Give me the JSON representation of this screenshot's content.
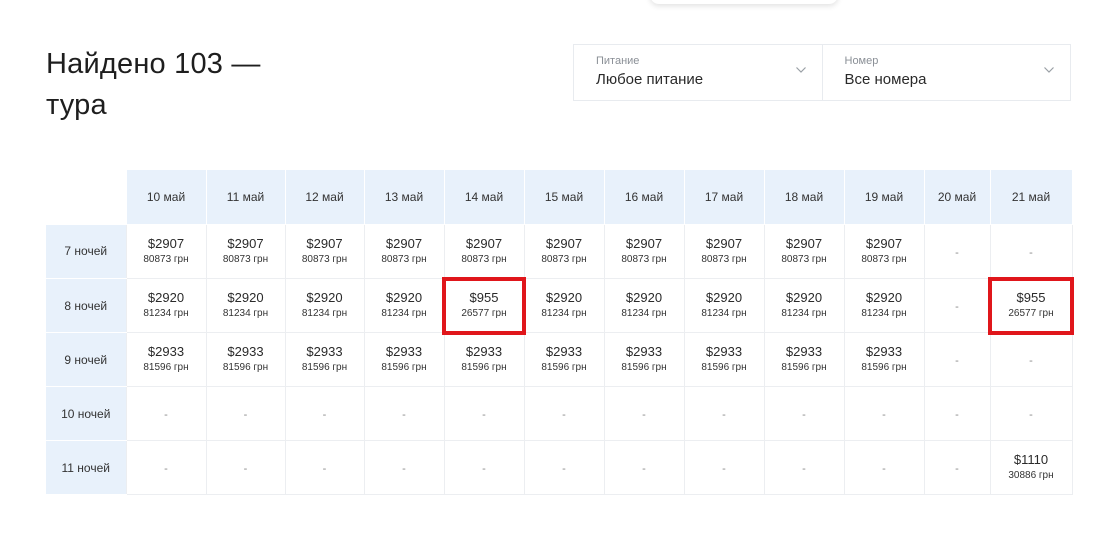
{
  "title": "Найдено 103 — тура",
  "filters": [
    {
      "label": "Питание",
      "value": "Любое питание"
    },
    {
      "label": "Номер",
      "value": "Все номера"
    }
  ],
  "dates": [
    "10 май",
    "11 май",
    "12 май",
    "13 май",
    "14 май",
    "15 май",
    "16 май",
    "17 май",
    "18 май",
    "19 май",
    "20 май",
    "21 май"
  ],
  "rows": [
    {
      "label": "7 ночей",
      "cells": [
        {
          "usd": "$2907",
          "uah": "80873 грн"
        },
        {
          "usd": "$2907",
          "uah": "80873 грн"
        },
        {
          "usd": "$2907",
          "uah": "80873 грн"
        },
        {
          "usd": "$2907",
          "uah": "80873 грн"
        },
        {
          "usd": "$2907",
          "uah": "80873 грн"
        },
        {
          "usd": "$2907",
          "uah": "80873 грн"
        },
        {
          "usd": "$2907",
          "uah": "80873 грн"
        },
        {
          "usd": "$2907",
          "uah": "80873 грн"
        },
        {
          "usd": "$2907",
          "uah": "80873 грн"
        },
        {
          "usd": "$2907",
          "uah": "80873 грн"
        },
        {
          "dash": "-"
        },
        {
          "dash": "-"
        }
      ]
    },
    {
      "label": "8 ночей",
      "cells": [
        {
          "usd": "$2920",
          "uah": "81234 грн"
        },
        {
          "usd": "$2920",
          "uah": "81234 грн"
        },
        {
          "usd": "$2920",
          "uah": "81234 грн"
        },
        {
          "usd": "$2920",
          "uah": "81234 грн"
        },
        {
          "usd": "$955",
          "uah": "26577 грн",
          "highlight": true
        },
        {
          "usd": "$2920",
          "uah": "81234 грн"
        },
        {
          "usd": "$2920",
          "uah": "81234 грн"
        },
        {
          "usd": "$2920",
          "uah": "81234 грн"
        },
        {
          "usd": "$2920",
          "uah": "81234 грн"
        },
        {
          "usd": "$2920",
          "uah": "81234 грн"
        },
        {
          "dash": "-"
        },
        {
          "usd": "$955",
          "uah": "26577 грн",
          "highlight": true
        }
      ]
    },
    {
      "label": "9 ночей",
      "cells": [
        {
          "usd": "$2933",
          "uah": "81596 грн"
        },
        {
          "usd": "$2933",
          "uah": "81596 грн"
        },
        {
          "usd": "$2933",
          "uah": "81596 грн"
        },
        {
          "usd": "$2933",
          "uah": "81596 грн"
        },
        {
          "usd": "$2933",
          "uah": "81596 грн"
        },
        {
          "usd": "$2933",
          "uah": "81596 грн"
        },
        {
          "usd": "$2933",
          "uah": "81596 грн"
        },
        {
          "usd": "$2933",
          "uah": "81596 грн"
        },
        {
          "usd": "$2933",
          "uah": "81596 грн"
        },
        {
          "usd": "$2933",
          "uah": "81596 грн"
        },
        {
          "dash": "-"
        },
        {
          "dash": "-"
        }
      ]
    },
    {
      "label": "10 ночей",
      "cells": [
        {
          "dash": "-"
        },
        {
          "dash": "-"
        },
        {
          "dash": "-"
        },
        {
          "dash": "-"
        },
        {
          "dash": "-"
        },
        {
          "dash": "-"
        },
        {
          "dash": "-"
        },
        {
          "dash": "-"
        },
        {
          "dash": "-"
        },
        {
          "dash": "-"
        },
        {
          "dash": "-"
        },
        {
          "dash": "-"
        }
      ]
    },
    {
      "label": "11 ночей",
      "cells": [
        {
          "dash": "-"
        },
        {
          "dash": "-"
        },
        {
          "dash": "-"
        },
        {
          "dash": "-"
        },
        {
          "dash": "-"
        },
        {
          "dash": "-"
        },
        {
          "dash": "-"
        },
        {
          "dash": "-"
        },
        {
          "dash": "-"
        },
        {
          "dash": "-"
        },
        {
          "dash": "-"
        },
        {
          "usd": "$1110",
          "uah": "30886 грн"
        }
      ]
    }
  ],
  "colors": {
    "header_bg": "#e8f1fb",
    "highlight": "#e0161b",
    "border": "#eceef1"
  },
  "icons": {
    "dropdown": "chevron-down-icon"
  }
}
